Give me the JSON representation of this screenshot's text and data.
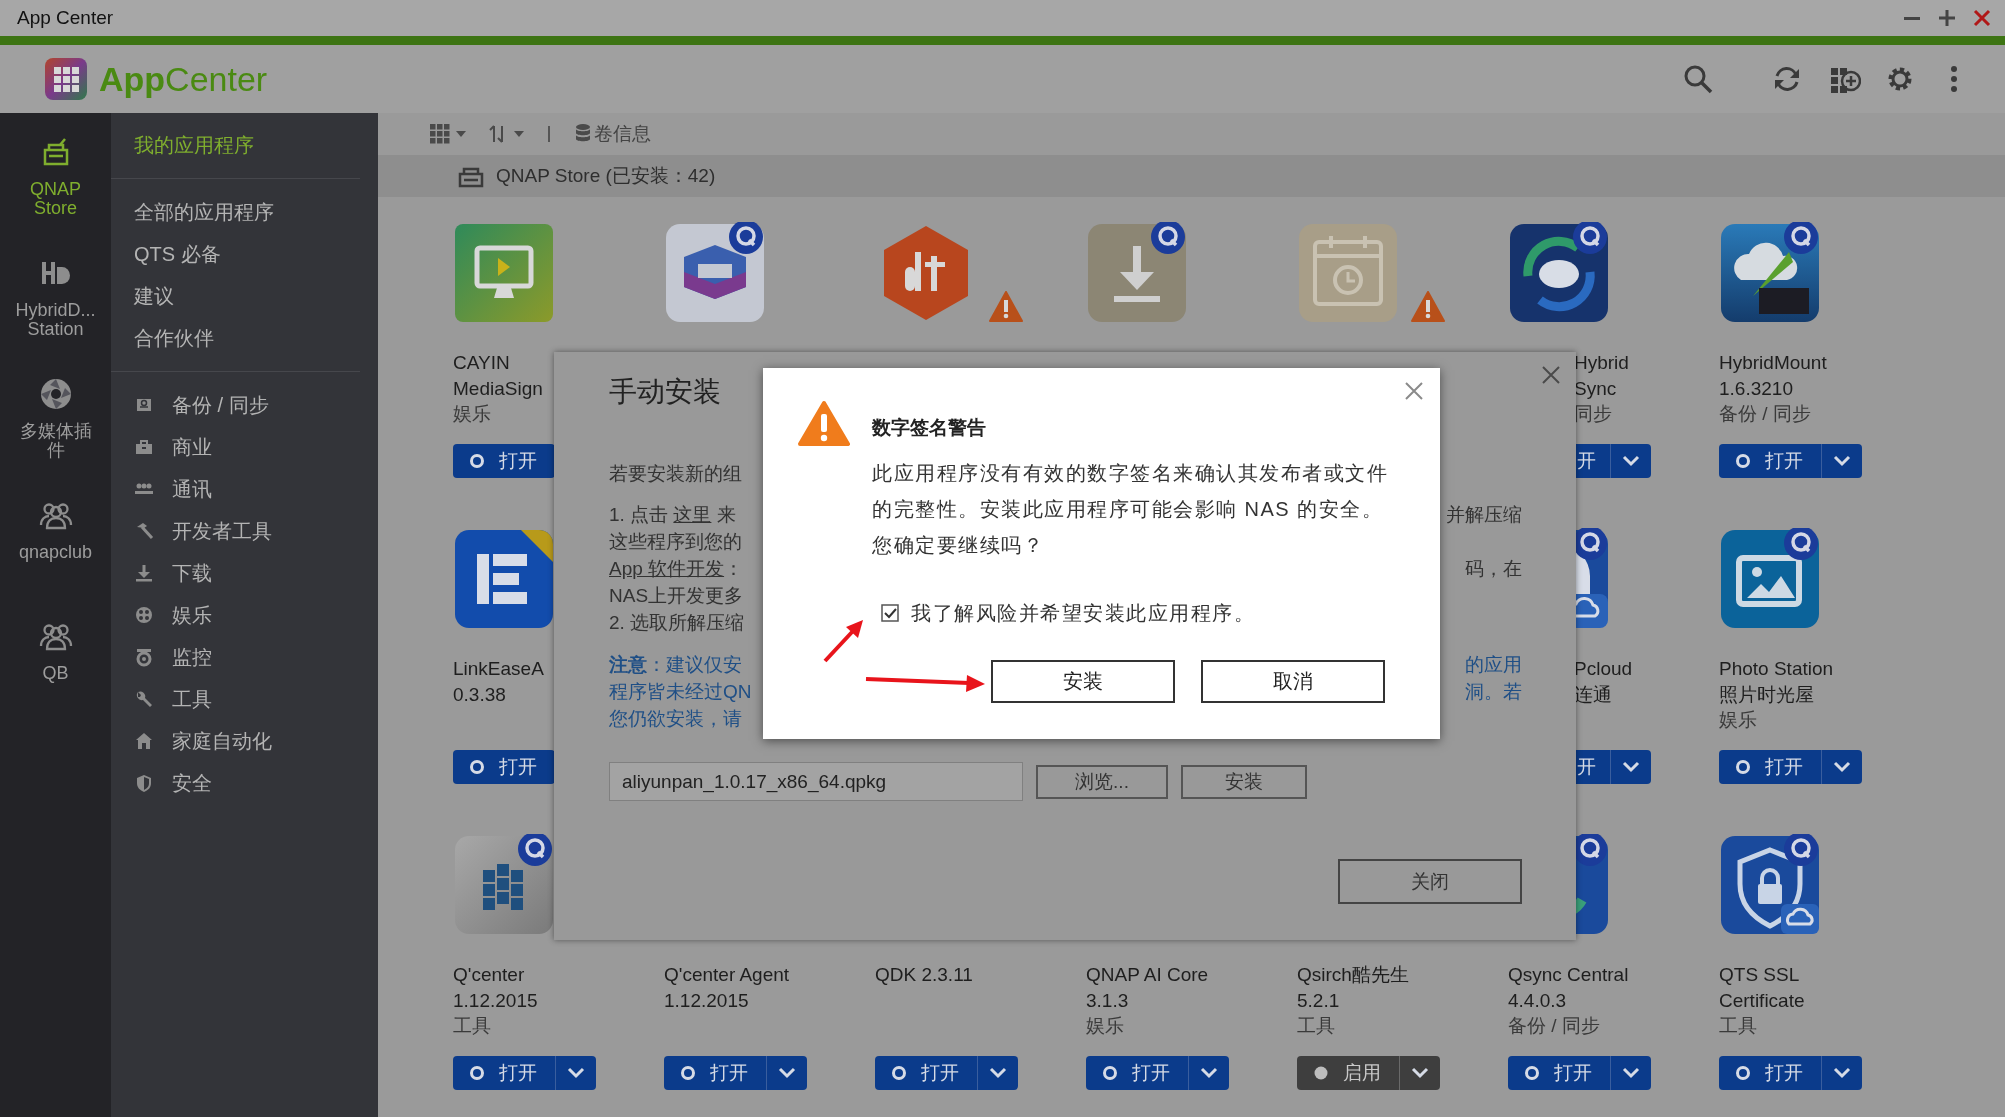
{
  "window": {
    "title": "App Center"
  },
  "header": {
    "logo": "**App**Center"
  },
  "rail": [
    {
      "label": "QNAP Store",
      "selected": true
    },
    {
      "label": "HybridD... Station",
      "selected": false
    },
    {
      "label": "多媒体插件",
      "selected": false
    },
    {
      "label": "qnapclub",
      "selected": false
    },
    {
      "label": "QB",
      "selected": false
    }
  ],
  "nav": {
    "top": [
      {
        "label": "我的应用程序",
        "selected": true
      }
    ],
    "store": [
      {
        "label": "全部的应用程序",
        "selected": false
      },
      {
        "label": "QTS 必备",
        "selected": false
      },
      {
        "label": "建议",
        "selected": false
      },
      {
        "label": "合作伙伴",
        "selected": false
      }
    ],
    "categories": [
      {
        "label": "备份 / 同步",
        "selected": false
      },
      {
        "label": "商业",
        "selected": false
      },
      {
        "label": "通讯",
        "selected": false
      },
      {
        "label": "开发者工具",
        "selected": false
      },
      {
        "label": "下载",
        "selected": false
      },
      {
        "label": "娱乐",
        "selected": false
      },
      {
        "label": "监控",
        "selected": false
      },
      {
        "label": "工具",
        "selected": false
      },
      {
        "label": "家庭自动化",
        "selected": false
      },
      {
        "label": "安全",
        "selected": false
      }
    ]
  },
  "toolbar": {
    "volume_info": "卷信息"
  },
  "section": {
    "title": "QNAP Store (已安装：42)"
  },
  "apps": [
    {
      "kind": "cut_right",
      "warning": false,
      "name_lines": [
        "CAYIN",
        "MediaSign"
      ],
      "category": "娱乐",
      "button": {
        "label": "打开",
        "active": true
      }
    },
    {
      "kind": "icon_only",
      "warning": false
    },
    {
      "kind": "icon_only",
      "warning": true
    },
    {
      "kind": "icon_only",
      "warning": false
    },
    {
      "kind": "icon_only",
      "warning": true
    },
    {
      "kind": "cut_left",
      "warning": false,
      "name_lines": [
        "Hybrid",
        "Sync"
      ],
      "category": "同步",
      "button": {
        "label": "开",
        "active": true
      }
    },
    {
      "kind": "full",
      "warning": false,
      "name_lines": [
        "HybridMount"
      ],
      "version": "1.6.3210",
      "category": "备份 / 同步",
      "button": {
        "label": "打开",
        "active": true
      }
    },
    {
      "kind": "cut_right",
      "warning": false,
      "name_lines": [
        "LinkEaseA"
      ],
      "version": "0.3.38",
      "button": {
        "label": "打开",
        "active": true
      }
    },
    {
      "kind": "covered"
    },
    {
      "kind": "covered"
    },
    {
      "kind": "covered"
    },
    {
      "kind": "covered"
    },
    {
      "kind": "cut_left",
      "warning": false,
      "name_lines": [
        "Pcloud",
        "连通"
      ],
      "button": {
        "label": "开",
        "active": true
      }
    },
    {
      "kind": "full",
      "warning": false,
      "name_lines": [
        "Photo Station",
        "照片时光屋"
      ],
      "category": "娱乐",
      "button": {
        "label": "打开",
        "active": true
      }
    },
    {
      "kind": "full",
      "warning": false,
      "name_lines": [
        "Q'center"
      ],
      "version": "1.12.2015",
      "category": "工具",
      "button": {
        "label": "打开",
        "active": true
      }
    },
    {
      "kind": "text_only",
      "name_lines": [
        "Q'center Agent"
      ],
      "version": "1.12.2015",
      "button": {
        "label": "打开",
        "active": true
      }
    },
    {
      "kind": "text_only",
      "name_lines": [
        "QDK 2.3.11"
      ],
      "button": {
        "label": "打开",
        "active": true
      }
    },
    {
      "kind": "text_only",
      "name_lines": [
        "QNAP AI Core"
      ],
      "version": "3.1.3",
      "category": "娱乐",
      "button": {
        "label": "打开",
        "active": true
      }
    },
    {
      "kind": "text_only",
      "name_lines": [
        "Qsirch酷先生"
      ],
      "version": "5.2.1",
      "category": "工具",
      "button": {
        "label": "启用",
        "active": false
      }
    },
    {
      "kind": "full",
      "warning": false,
      "name_lines": [
        "Qsync Central"
      ],
      "version": "4.4.0.3",
      "category": "备份 / 同步",
      "button": {
        "label": "打开",
        "active": true
      }
    },
    {
      "kind": "full",
      "warning": false,
      "name_lines": [
        "QTS SSL",
        "Certificate"
      ],
      "category": "工具",
      "button": {
        "label": "打开",
        "active": true
      }
    }
  ],
  "manual_dialog": {
    "title": "手动安装",
    "lines": [
      {
        "kind": "intro",
        "parts": [
          {
            "text": "若要安装新的组"
          }
        ]
      },
      {
        "kind": "step",
        "parts": [
          {
            "text": "1. 点击 "
          },
          {
            "text": "这里",
            "link": true
          },
          {
            "text": " 来"
          }
        ],
        "right": "并解压缩"
      },
      {
        "kind": "step",
        "parts": [
          {
            "text": "这些程序到您的"
          }
        ]
      },
      {
        "kind": "step",
        "parts": [
          {
            "text": "App 软件开发",
            "link": true
          },
          {
            "text": "："
          }
        ],
        "right": "码，在"
      },
      {
        "kind": "step",
        "parts": [
          {
            "text": "NAS上开发更多"
          }
        ]
      },
      {
        "kind": "step",
        "parts": [
          {
            "text": "2. 选取所解压缩"
          }
        ]
      },
      {
        "kind": "note",
        "parts": [
          {
            "text": "**注意**：建议仅安"
          }
        ],
        "right": "的应用"
      },
      {
        "kind": "note",
        "parts": [
          {
            "text": "程序皆未经过QN"
          }
        ],
        "right": "洞。若"
      },
      {
        "kind": "note",
        "parts": [
          {
            "text": "您仍欲安装，请"
          }
        ]
      }
    ],
    "file": {
      "value": "aliyunpan_1.0.17_x86_64.qpkg"
    },
    "browse": "浏览...",
    "install": "安装",
    "close": "关闭"
  },
  "warning_dialog": {
    "title": "数字签名警告",
    "message_lines": [
      "此应用程序没有有效的数字签名来确认其发布者或文件",
      "的完整性。安装此应用程序可能会影响 NAS 的安全。",
      "您确定要继续吗？"
    ],
    "checkbox": {
      "label": "我了解风险并希望安装此应用程序。",
      "checked": true
    },
    "buttons": [
      "安装",
      "取消"
    ]
  }
}
